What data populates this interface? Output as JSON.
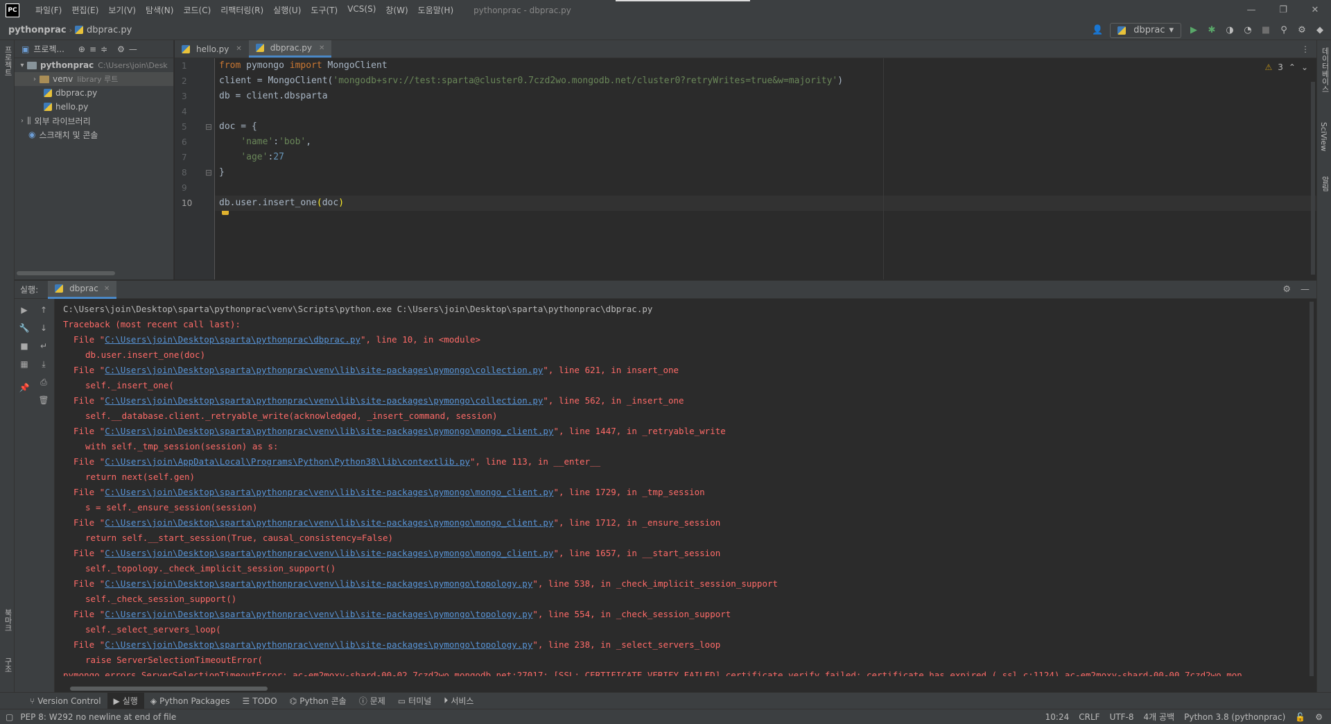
{
  "window": {
    "logo": "PC",
    "title": "pythonprac - dbprac.py",
    "menu": [
      "파일(F)",
      "편집(E)",
      "보기(V)",
      "탐색(N)",
      "코드(C)",
      "리팩터링(R)",
      "실행(U)",
      "도구(T)",
      "VCS(S)",
      "창(W)",
      "도움말(H)"
    ]
  },
  "navbar": {
    "project": "pythonprac",
    "file": "dbprac.py",
    "run_config": "dbprac"
  },
  "left_stripe": {
    "top_label": "프로젝트",
    "bottom_label_1": "북마크",
    "bottom_label_2": "구조"
  },
  "right_stripe": {
    "label_1": "데이터베이스",
    "label_2": "SciView",
    "label_3": "알림"
  },
  "project_panel": {
    "title": "프로젝...",
    "root": "pythonprac",
    "root_path": "C:\\Users\\join\\Desk",
    "venv": "venv",
    "venv_note": "library 루트",
    "files": [
      "dbprac.py",
      "hello.py"
    ],
    "external_libs": "외부 라이브러리",
    "scratches": "스크래치 및 콘솔"
  },
  "editor": {
    "tabs": [
      "hello.py",
      "dbprac.py"
    ],
    "active_tab": "dbprac.py",
    "warnings": "3",
    "lines": [
      "from pymongo import MongoClient",
      "client = MongoClient('mongodb+srv://test:sparta@cluster0.7czd2wo.mongodb.net/cluster0?retryWrites=true&w=majority')",
      "db = client.dbsparta",
      "",
      "doc = {",
      "    'name':'bob',",
      "    'age':27",
      "}",
      "",
      "db.user.insert_one(doc)"
    ]
  },
  "run": {
    "label": "실행:",
    "tab": "dbprac",
    "command": "C:\\Users\\join\\Desktop\\sparta\\pythonprac\\venv\\Scripts\\python.exe C:\\Users\\join\\Desktop\\sparta\\pythonprac\\dbprac.py",
    "traceback_head": "Traceback (most recent call last):",
    "frames": [
      {
        "path": "C:\\Users\\join\\Desktop\\sparta\\pythonprac\\dbprac.py",
        "rest": "\", line 10, in <module>",
        "code": "db.user.insert_one(doc)"
      },
      {
        "path": "C:\\Users\\join\\Desktop\\sparta\\pythonprac\\venv\\lib\\site-packages\\pymongo\\collection.py",
        "rest": "\", line 621, in insert_one",
        "code": "self._insert_one("
      },
      {
        "path": "C:\\Users\\join\\Desktop\\sparta\\pythonprac\\venv\\lib\\site-packages\\pymongo\\collection.py",
        "rest": "\", line 562, in _insert_one",
        "code": "self.__database.client._retryable_write(acknowledged, _insert_command, session)"
      },
      {
        "path": "C:\\Users\\join\\Desktop\\sparta\\pythonprac\\venv\\lib\\site-packages\\pymongo\\mongo_client.py",
        "rest": "\", line 1447, in _retryable_write",
        "code": "with self._tmp_session(session) as s:"
      },
      {
        "path": "C:\\Users\\join\\AppData\\Local\\Programs\\Python\\Python38\\lib\\contextlib.py",
        "rest": "\", line 113, in __enter__",
        "code": "return next(self.gen)"
      },
      {
        "path": "C:\\Users\\join\\Desktop\\sparta\\pythonprac\\venv\\lib\\site-packages\\pymongo\\mongo_client.py",
        "rest": "\", line 1729, in _tmp_session",
        "code": "s = self._ensure_session(session)"
      },
      {
        "path": "C:\\Users\\join\\Desktop\\sparta\\pythonprac\\venv\\lib\\site-packages\\pymongo\\mongo_client.py",
        "rest": "\", line 1712, in _ensure_session",
        "code": "return self.__start_session(True, causal_consistency=False)"
      },
      {
        "path": "C:\\Users\\join\\Desktop\\sparta\\pythonprac\\venv\\lib\\site-packages\\pymongo\\mongo_client.py",
        "rest": "\", line 1657, in __start_session",
        "code": "self._topology._check_implicit_session_support()"
      },
      {
        "path": "C:\\Users\\join\\Desktop\\sparta\\pythonprac\\venv\\lib\\site-packages\\pymongo\\topology.py",
        "rest": "\", line 538, in _check_implicit_session_support",
        "code": "self._check_session_support()"
      },
      {
        "path": "C:\\Users\\join\\Desktop\\sparta\\pythonprac\\venv\\lib\\site-packages\\pymongo\\topology.py",
        "rest": "\", line 554, in _check_session_support",
        "code": "self._select_servers_loop("
      },
      {
        "path": "C:\\Users\\join\\Desktop\\sparta\\pythonprac\\venv\\lib\\site-packages\\pymongo\\topology.py",
        "rest": "\", line 238, in _select_servers_loop",
        "code": "raise ServerSelectionTimeoutError("
      }
    ],
    "error": "pymongo.errors.ServerSelectionTimeoutError: ac-em2moxy-shard-00-02.7czd2wo.mongodb.net:27017: [SSL: CERTIFICATE_VERIFY_FAILED] certificate verify failed: certificate has expired (_ssl.c:1124),ac-em2moxy-shard-00-00.7czd2wo.mon"
  },
  "bottom_tools": [
    "Version Control",
    "실행",
    "Python Packages",
    "TODO",
    "Python 콘솔",
    "문제",
    "터미널",
    "서비스"
  ],
  "status": {
    "message": "PEP 8: W292 no newline at end of file",
    "position": "10:24",
    "line_sep": "CRLF",
    "encoding": "UTF-8",
    "indent": "4개 공백",
    "interpreter": "Python 3.8 (pythonprac)"
  }
}
